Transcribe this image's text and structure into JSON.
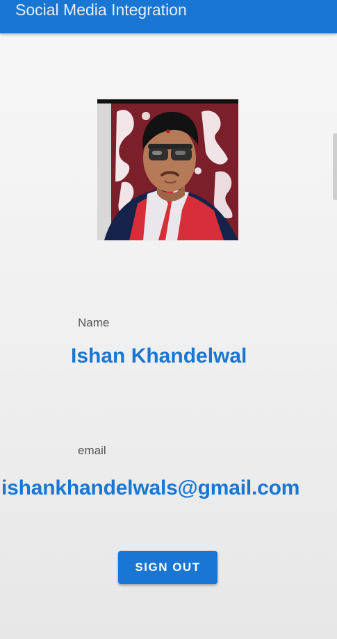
{
  "app_bar": {
    "title": "Social Media Integration"
  },
  "profile": {
    "photo_icon": "profile-photo",
    "name_label": "Name",
    "name_value": "Ishan Khandelwal",
    "email_label": "email",
    "email_value": "ishankhandelwals@gmail.com"
  },
  "actions": {
    "sign_out_label": "SIGN OUT"
  },
  "colors": {
    "primary": "#1976d2",
    "label_text": "#555555",
    "background": "#f1f1f1"
  }
}
